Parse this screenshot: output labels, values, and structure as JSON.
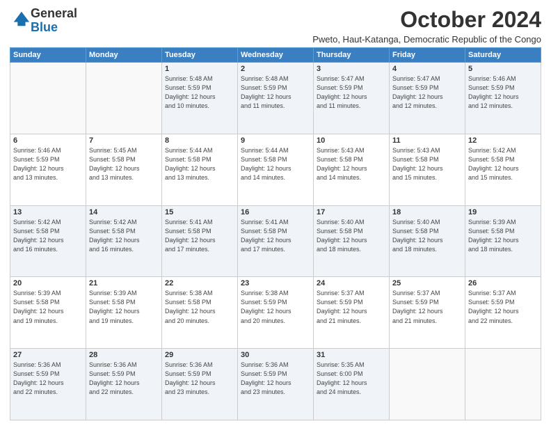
{
  "logo": {
    "general": "General",
    "blue": "Blue"
  },
  "header": {
    "month": "October 2024",
    "location": "Pweto, Haut-Katanga, Democratic Republic of the Congo"
  },
  "weekdays": [
    "Sunday",
    "Monday",
    "Tuesday",
    "Wednesday",
    "Thursday",
    "Friday",
    "Saturday"
  ],
  "weeks": [
    [
      {
        "day": "",
        "info": ""
      },
      {
        "day": "",
        "info": ""
      },
      {
        "day": "1",
        "info": "Sunrise: 5:48 AM\nSunset: 5:59 PM\nDaylight: 12 hours\nand 10 minutes."
      },
      {
        "day": "2",
        "info": "Sunrise: 5:48 AM\nSunset: 5:59 PM\nDaylight: 12 hours\nand 11 minutes."
      },
      {
        "day": "3",
        "info": "Sunrise: 5:47 AM\nSunset: 5:59 PM\nDaylight: 12 hours\nand 11 minutes."
      },
      {
        "day": "4",
        "info": "Sunrise: 5:47 AM\nSunset: 5:59 PM\nDaylight: 12 hours\nand 12 minutes."
      },
      {
        "day": "5",
        "info": "Sunrise: 5:46 AM\nSunset: 5:59 PM\nDaylight: 12 hours\nand 12 minutes."
      }
    ],
    [
      {
        "day": "6",
        "info": "Sunrise: 5:46 AM\nSunset: 5:59 PM\nDaylight: 12 hours\nand 13 minutes."
      },
      {
        "day": "7",
        "info": "Sunrise: 5:45 AM\nSunset: 5:58 PM\nDaylight: 12 hours\nand 13 minutes."
      },
      {
        "day": "8",
        "info": "Sunrise: 5:44 AM\nSunset: 5:58 PM\nDaylight: 12 hours\nand 13 minutes."
      },
      {
        "day": "9",
        "info": "Sunrise: 5:44 AM\nSunset: 5:58 PM\nDaylight: 12 hours\nand 14 minutes."
      },
      {
        "day": "10",
        "info": "Sunrise: 5:43 AM\nSunset: 5:58 PM\nDaylight: 12 hours\nand 14 minutes."
      },
      {
        "day": "11",
        "info": "Sunrise: 5:43 AM\nSunset: 5:58 PM\nDaylight: 12 hours\nand 15 minutes."
      },
      {
        "day": "12",
        "info": "Sunrise: 5:42 AM\nSunset: 5:58 PM\nDaylight: 12 hours\nand 15 minutes."
      }
    ],
    [
      {
        "day": "13",
        "info": "Sunrise: 5:42 AM\nSunset: 5:58 PM\nDaylight: 12 hours\nand 16 minutes."
      },
      {
        "day": "14",
        "info": "Sunrise: 5:42 AM\nSunset: 5:58 PM\nDaylight: 12 hours\nand 16 minutes."
      },
      {
        "day": "15",
        "info": "Sunrise: 5:41 AM\nSunset: 5:58 PM\nDaylight: 12 hours\nand 17 minutes."
      },
      {
        "day": "16",
        "info": "Sunrise: 5:41 AM\nSunset: 5:58 PM\nDaylight: 12 hours\nand 17 minutes."
      },
      {
        "day": "17",
        "info": "Sunrise: 5:40 AM\nSunset: 5:58 PM\nDaylight: 12 hours\nand 18 minutes."
      },
      {
        "day": "18",
        "info": "Sunrise: 5:40 AM\nSunset: 5:58 PM\nDaylight: 12 hours\nand 18 minutes."
      },
      {
        "day": "19",
        "info": "Sunrise: 5:39 AM\nSunset: 5:58 PM\nDaylight: 12 hours\nand 18 minutes."
      }
    ],
    [
      {
        "day": "20",
        "info": "Sunrise: 5:39 AM\nSunset: 5:58 PM\nDaylight: 12 hours\nand 19 minutes."
      },
      {
        "day": "21",
        "info": "Sunrise: 5:39 AM\nSunset: 5:58 PM\nDaylight: 12 hours\nand 19 minutes."
      },
      {
        "day": "22",
        "info": "Sunrise: 5:38 AM\nSunset: 5:58 PM\nDaylight: 12 hours\nand 20 minutes."
      },
      {
        "day": "23",
        "info": "Sunrise: 5:38 AM\nSunset: 5:59 PM\nDaylight: 12 hours\nand 20 minutes."
      },
      {
        "day": "24",
        "info": "Sunrise: 5:37 AM\nSunset: 5:59 PM\nDaylight: 12 hours\nand 21 minutes."
      },
      {
        "day": "25",
        "info": "Sunrise: 5:37 AM\nSunset: 5:59 PM\nDaylight: 12 hours\nand 21 minutes."
      },
      {
        "day": "26",
        "info": "Sunrise: 5:37 AM\nSunset: 5:59 PM\nDaylight: 12 hours\nand 22 minutes."
      }
    ],
    [
      {
        "day": "27",
        "info": "Sunrise: 5:36 AM\nSunset: 5:59 PM\nDaylight: 12 hours\nand 22 minutes."
      },
      {
        "day": "28",
        "info": "Sunrise: 5:36 AM\nSunset: 5:59 PM\nDaylight: 12 hours\nand 22 minutes."
      },
      {
        "day": "29",
        "info": "Sunrise: 5:36 AM\nSunset: 5:59 PM\nDaylight: 12 hours\nand 23 minutes."
      },
      {
        "day": "30",
        "info": "Sunrise: 5:36 AM\nSunset: 5:59 PM\nDaylight: 12 hours\nand 23 minutes."
      },
      {
        "day": "31",
        "info": "Sunrise: 5:35 AM\nSunset: 6:00 PM\nDaylight: 12 hours\nand 24 minutes."
      },
      {
        "day": "",
        "info": ""
      },
      {
        "day": "",
        "info": ""
      }
    ]
  ]
}
